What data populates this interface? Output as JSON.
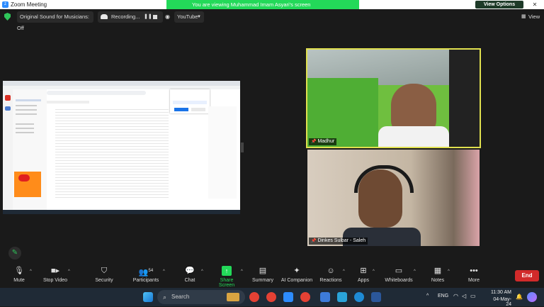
{
  "window": {
    "title": "Zoom Meeting",
    "minimize": "—",
    "restore": "❐",
    "close": "✕"
  },
  "banner": {
    "text": "You are viewing Muhammad Imam Asyari's screen",
    "view_options": "View Options"
  },
  "topbar": {
    "original_sound": "Original Sound for Musicians: Off",
    "recording": "Recording...",
    "youtube": "YouTube",
    "view": "View"
  },
  "participants": [
    {
      "name": "Madhur",
      "active_speaker": true
    },
    {
      "name": "Dinkes Sulbar - Saleh",
      "active_speaker": false
    }
  ],
  "toolbar": {
    "mute": "Mute",
    "stop_video": "Stop Video",
    "security": "Security",
    "participants": "Participants",
    "participant_count": "54",
    "chat": "Chat",
    "share_screen": "Share Screen",
    "summary": "Summary",
    "ai_companion": "AI Companion",
    "reactions": "Reactions",
    "apps": "Apps",
    "whiteboards": "Whiteboards",
    "notes": "Notes",
    "more": "More",
    "end": "End"
  },
  "taskbar": {
    "search_placeholder": "Search",
    "lang": "ENG",
    "time": "11:30 AM",
    "date": "04-May-24"
  },
  "colors": {
    "accent_green": "#23d959",
    "end_red": "#d12a2a",
    "speaker_border": "#e0e04f"
  }
}
